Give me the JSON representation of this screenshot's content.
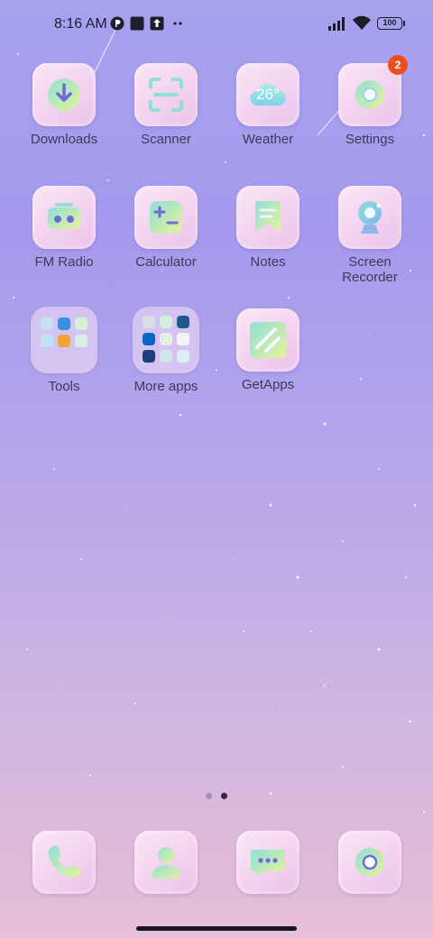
{
  "status_bar": {
    "time": "8:16 AM",
    "battery": "100",
    "notification_icons": [
      "p-icon",
      "square-app-icon",
      "upload-icon",
      "more-dots-icon"
    ]
  },
  "apps": [
    {
      "label": "Downloads",
      "icon": "download-icon"
    },
    {
      "label": "Scanner",
      "icon": "scanner-icon"
    },
    {
      "label": "Weather",
      "icon": "weather-icon",
      "temperature": "26°"
    },
    {
      "label": "Settings",
      "icon": "settings-icon",
      "badge": "2"
    },
    {
      "label": "FM Radio",
      "icon": "radio-icon"
    },
    {
      "label": "Calculator",
      "icon": "calculator-icon"
    },
    {
      "label": "Notes",
      "icon": "notes-icon"
    },
    {
      "label": "Screen Recorder",
      "icon": "screen-recorder-icon"
    },
    {
      "label": "Tools",
      "icon": "folder-icon"
    },
    {
      "label": "More apps",
      "icon": "folder-icon"
    },
    {
      "label": "GetApps",
      "icon": "getapps-icon"
    }
  ],
  "dock": [
    {
      "name": "Phone",
      "icon": "phone-icon"
    },
    {
      "name": "Contacts",
      "icon": "contacts-icon"
    },
    {
      "name": "Messages",
      "icon": "messages-icon"
    },
    {
      "name": "Camera",
      "icon": "camera-icon"
    }
  ],
  "page_indicator": {
    "pages": 2,
    "current": 2
  },
  "colors": {
    "badge": "#ee4e1c",
    "label_text": "#3c3c55",
    "icon_teal": "#8fe0d6",
    "icon_yellow": "#e6f29a"
  }
}
